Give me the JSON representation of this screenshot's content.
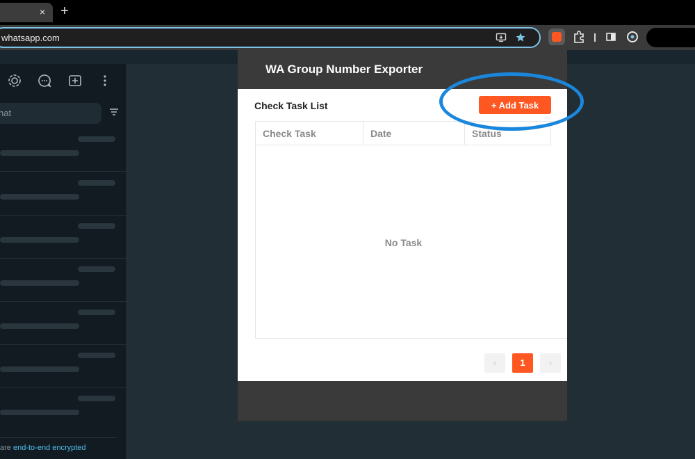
{
  "browser": {
    "tab_close": "×",
    "new_tab": "+",
    "url": "whatsapp.com",
    "install_icon": "install-app-icon",
    "star_icon": "bookmark-star-icon",
    "extension_icon": "extension-icon",
    "puzzle_icon": "puzzle-icon",
    "sidepanel_icon": "side-panel-icon",
    "profile_icon": "profile-icon"
  },
  "whatsapp": {
    "search_placeholder": "hat",
    "footer_prefix": "are ",
    "footer_link": "end-to-end encrypted",
    "chat_count": 7
  },
  "popup": {
    "title": "WA Group Number Exporter",
    "list_title": "Check Task List",
    "add_button": "+ Add Task",
    "columns": [
      "Check Task",
      "Date",
      "Status"
    ],
    "empty_text": "No Task",
    "pagination": {
      "prev": "‹",
      "current": "1",
      "next": "›"
    }
  },
  "colors": {
    "accent": "#ff5722",
    "highlight": "#1a87dd"
  }
}
